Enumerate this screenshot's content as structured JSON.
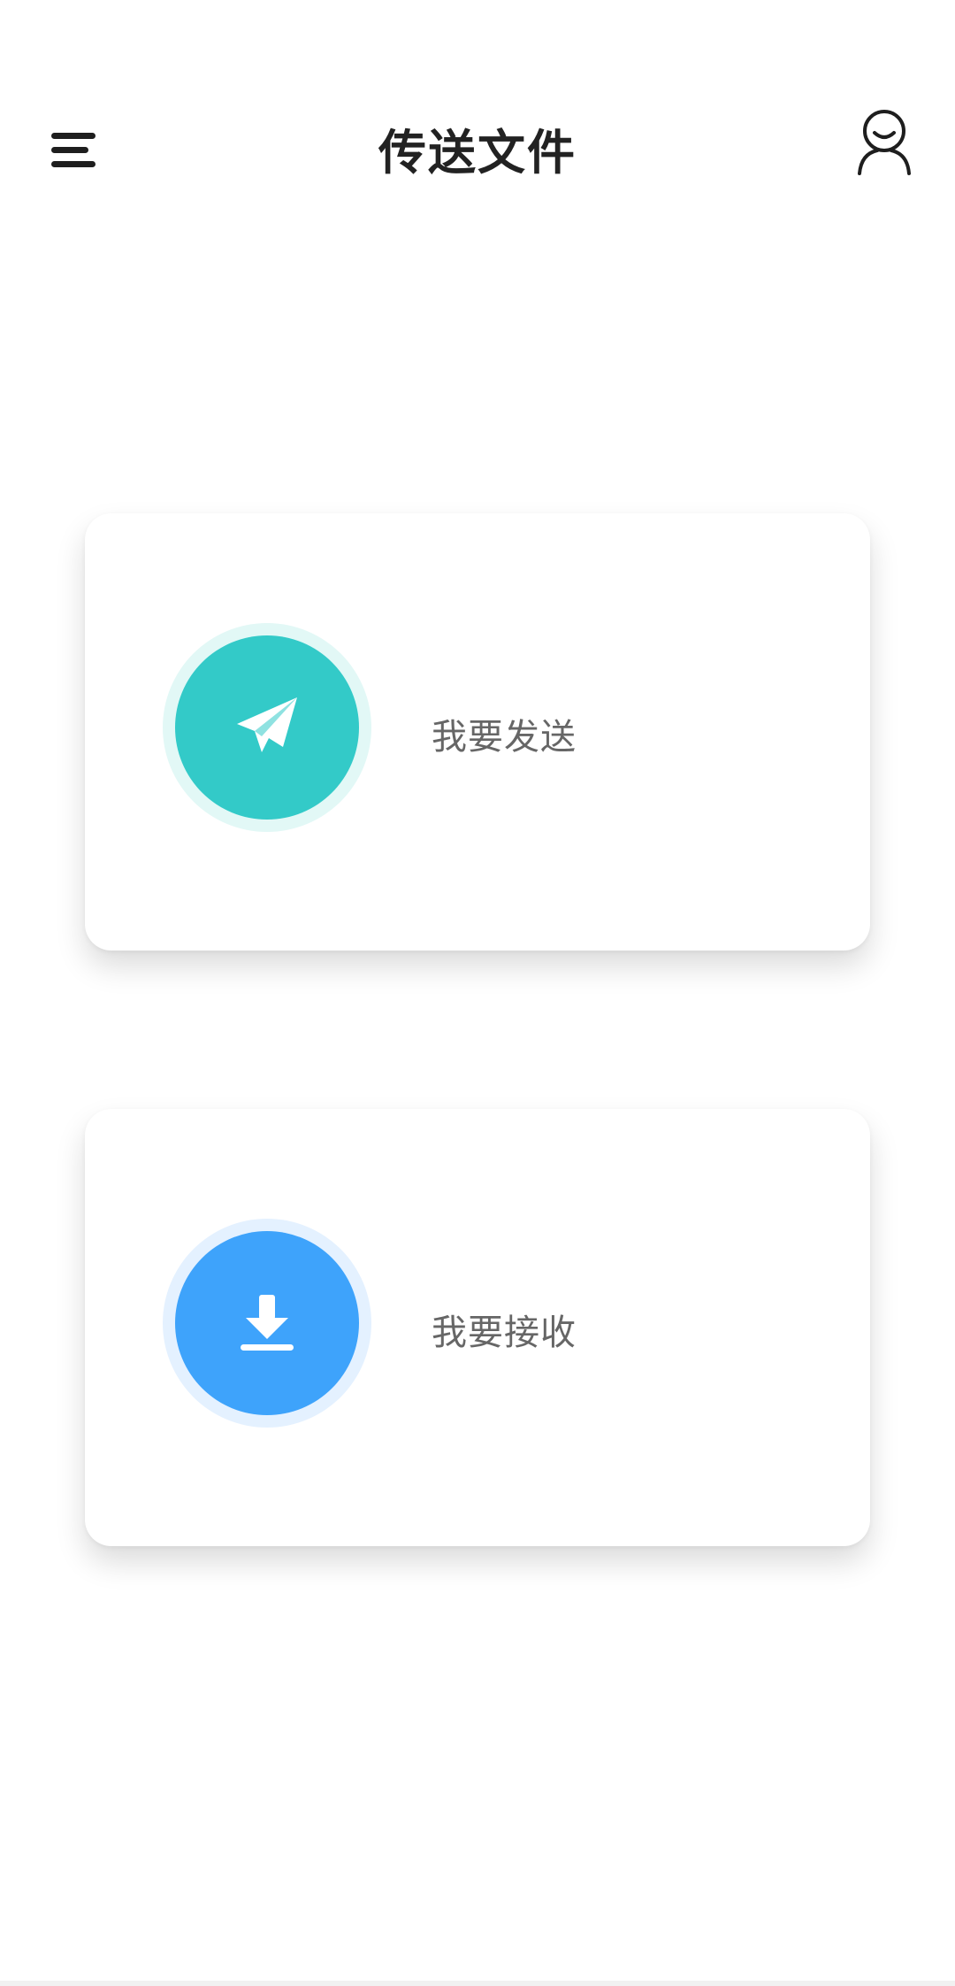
{
  "header": {
    "title": "传送文件",
    "menu_icon": "menu-icon",
    "user_icon": "user-icon"
  },
  "actions": [
    {
      "label": "我要发送",
      "icon": "paper-plane-icon",
      "color": "#33cac8"
    },
    {
      "label": "我要接收",
      "icon": "download-icon",
      "color": "#3ea3fb"
    }
  ]
}
